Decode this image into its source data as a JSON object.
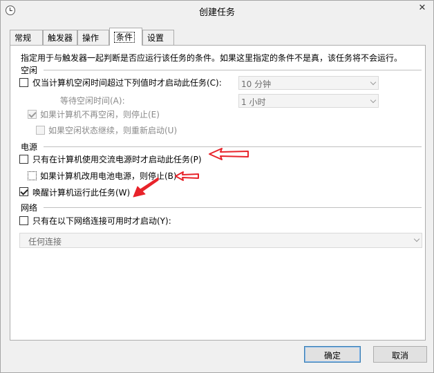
{
  "window": {
    "title": "创建任务"
  },
  "tabs": [
    {
      "label": "常规"
    },
    {
      "label": "触发器"
    },
    {
      "label": "操作"
    },
    {
      "label": "条件"
    },
    {
      "label": "设置"
    }
  ],
  "conditions": {
    "intro": "指定用于与触发器一起判断是否应运行该任务的条件。如果这里指定的条件不是真，该任务将不会运行。",
    "idle": {
      "header": "空闲",
      "start_if_idle": {
        "label": "仅当计算机空闲时间超过下列值时才启动此任务(C):",
        "checked": false
      },
      "idle_duration": "10 分钟",
      "wait_label": "等待空闲时间(A):",
      "wait_duration": "1 小时",
      "stop_if_not_idle": {
        "label": "如果计算机不再空闲，则停止(E)",
        "checked": true,
        "enabled": false
      },
      "restart_if_idle": {
        "label": "如果空闲状态继续，则重新启动(U)",
        "checked": false,
        "enabled": false
      }
    },
    "power": {
      "header": "电源",
      "ac_only": {
        "label": "只有在计算机使用交流电源时才启动此任务(P)",
        "checked": false
      },
      "stop_on_battery": {
        "label": "如果计算机改用电池电源，则停止(B)",
        "checked": false
      },
      "wake_to_run": {
        "label": "唤醒计算机运行此任务(W)",
        "checked": true
      }
    },
    "network": {
      "header": "网络",
      "network_only": {
        "label": "只有在以下网络连接可用时才启动(Y):",
        "checked": false
      },
      "connection": "任何连接"
    }
  },
  "buttons": {
    "ok": "确定",
    "cancel": "取消"
  },
  "colors": {
    "annotation_arrow": "#e8232a",
    "default_button_border": "#3c7fb1"
  }
}
